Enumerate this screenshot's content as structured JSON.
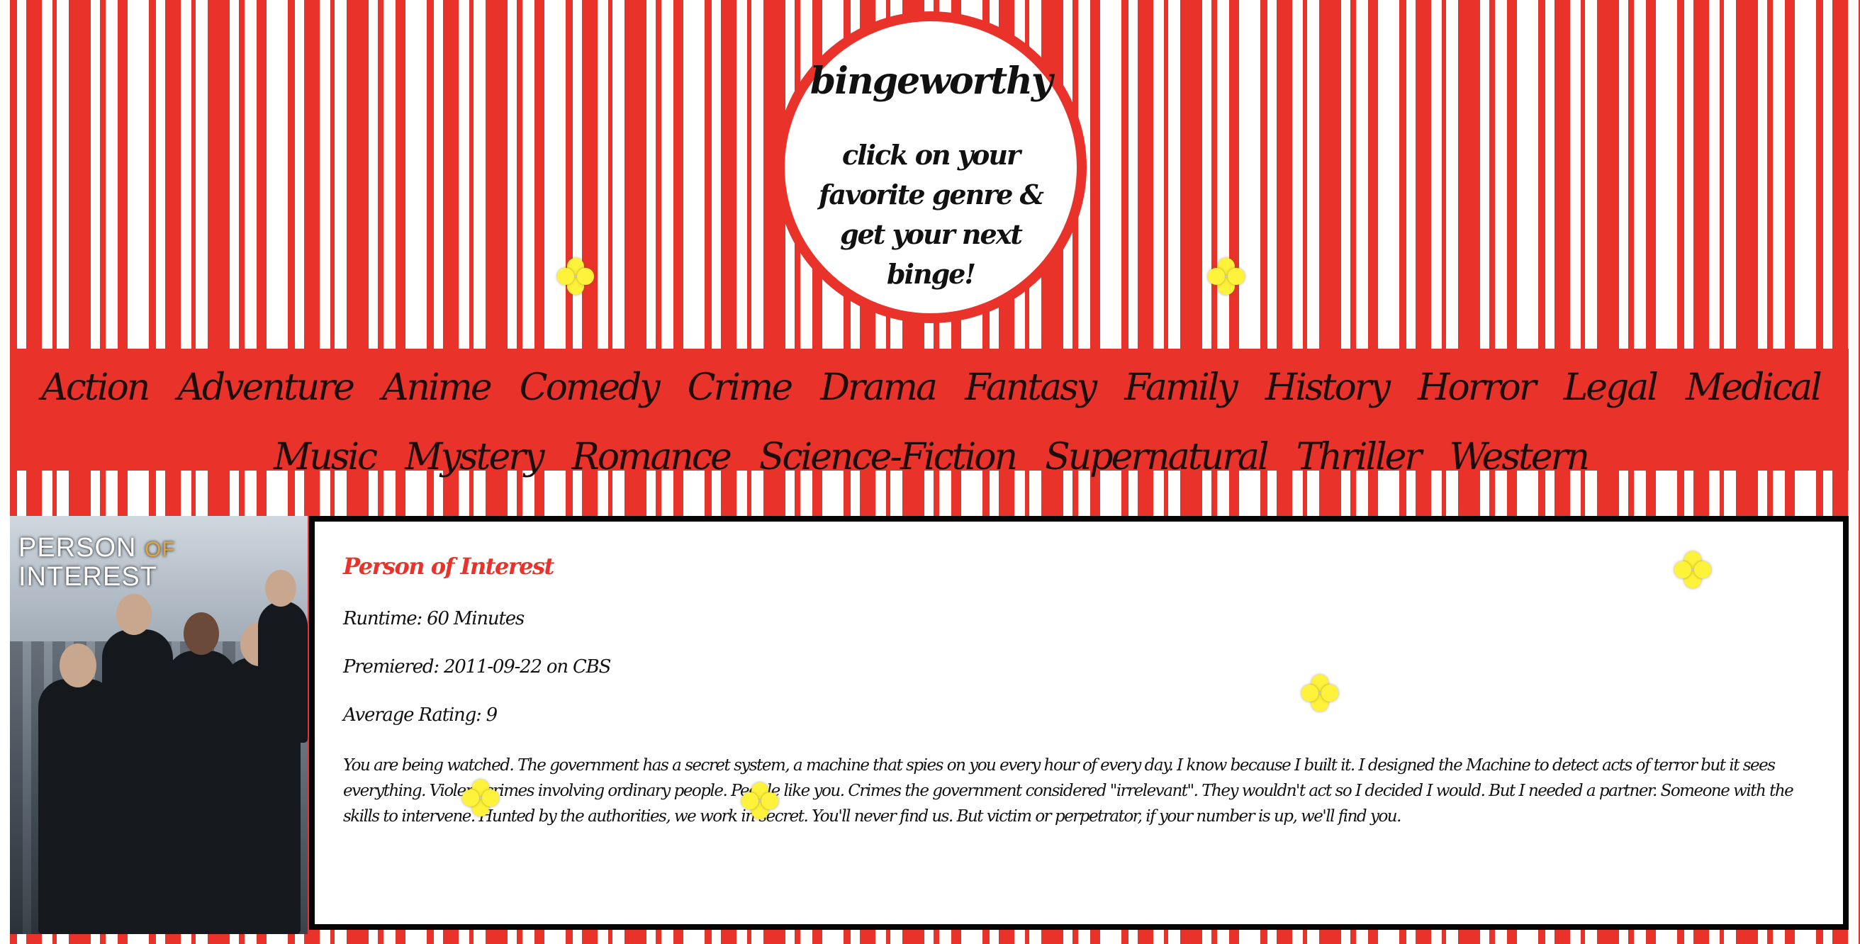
{
  "header": {
    "title": "bingeworthy",
    "tagline": "click on your favorite genre & get your next binge!"
  },
  "genres": [
    "Action",
    "Adventure",
    "Anime",
    "Comedy",
    "Crime",
    "Drama",
    "Fantasy",
    "Family",
    "History",
    "Horror",
    "Legal",
    "Medical",
    "Music",
    "Mystery",
    "Romance",
    "Science-Fiction",
    "Supernatural",
    "Thriller",
    "Western"
  ],
  "show": {
    "poster_title_line1": "PERSON",
    "poster_title_of": "OF",
    "poster_title_line2": "INTEREST",
    "name": "Person of Interest",
    "runtime": "Runtime: 60 Minutes",
    "premiered": "Premiered: 2011-09-22 on CBS",
    "rating": "Average Rating: 9",
    "summary": "You are being watched. The government has a secret system, a machine that spies on you every hour of every day. I know because I built it. I designed the Machine to detect acts of terror but it sees everything. Violent crimes involving ordinary people. People like you. Crimes the government considered \"irrelevant\". They wouldn't act so I decided I would. But I needed a partner. Someone with the skills to intervene. Hunted by the authorities, we work in secret. You'll never find us. But victim or perpetrator, if your number is up, we'll find you."
  },
  "colors": {
    "accent_red": "#e8322a",
    "sparkle_yellow": "#fff23b",
    "panel_border": "#050505"
  },
  "icons": [
    "sparkle-icon"
  ]
}
